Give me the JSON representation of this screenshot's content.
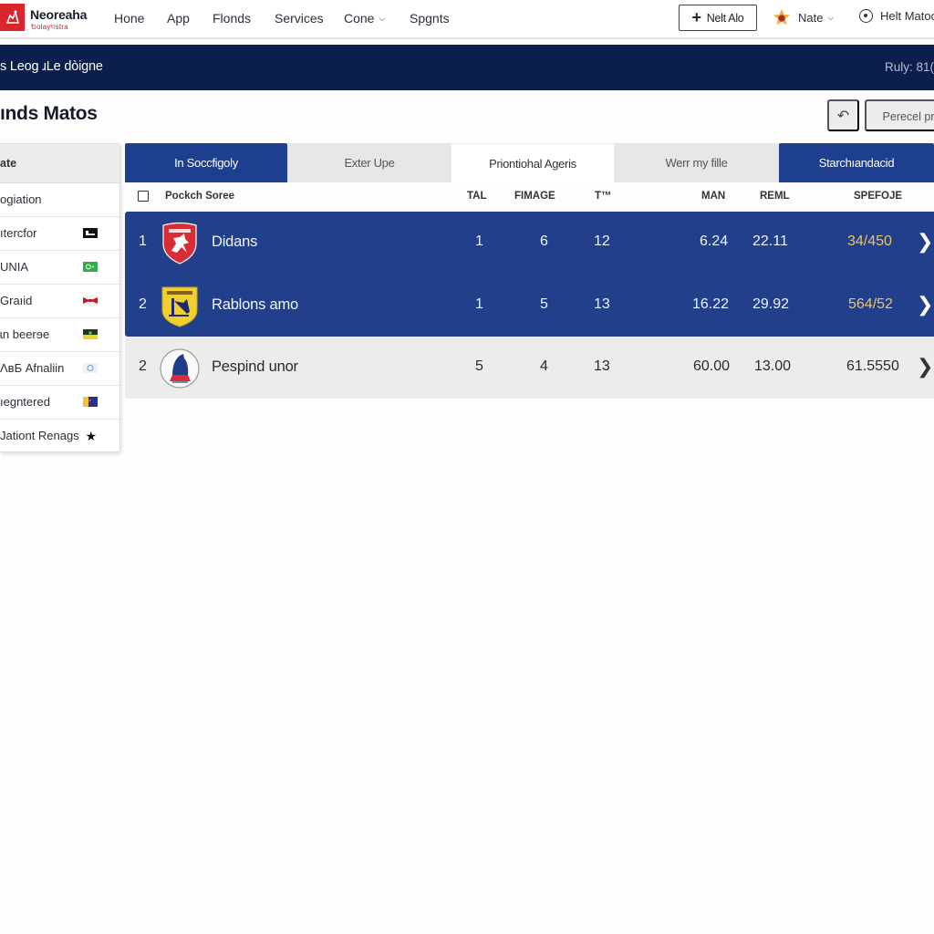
{
  "nav": {
    "brand_name": "Neoreaha",
    "brand_sub": "Եolayঘstra",
    "links": [
      {
        "label": "Hone"
      },
      {
        "label": "App"
      },
      {
        "label": "Flonds"
      },
      {
        "label": "Services"
      },
      {
        "label": "Cone",
        "has_dropdown": true
      },
      {
        "label": "Spgnts"
      }
    ],
    "new_button": "Nelt Alo",
    "user_name": "Nate",
    "help_link": "Helt Matoc"
  },
  "banner": {
    "title": "s Leog ɹLe dòigne",
    "right_text": "Ruly: 81("
  },
  "page": {
    "title": "ınds Matos",
    "back_icon": "reply-arrow-icon",
    "action_button": "Perecel pro"
  },
  "sidebar": {
    "header": "ate",
    "items": [
      {
        "label": "ogiation",
        "flag": null
      },
      {
        "label": "ıtercfor",
        "flag": "black"
      },
      {
        "label": "UNIA",
        "flag": "green"
      },
      {
        "label": "Graıid",
        "flag": "red-white"
      },
      {
        "label": "ɩn beerɘe",
        "flag": "green-yellow"
      },
      {
        "label": "ɅвБ Afnaliin",
        "flag": "circle"
      },
      {
        "label": "ıegntered",
        "flag": "yellow-blue"
      },
      {
        "label": "Jationt Renags",
        "flag": "star"
      }
    ]
  },
  "tabs": [
    {
      "label": "In Soccfigoly",
      "state": "active"
    },
    {
      "label": "Exter Upe",
      "state": "grey"
    },
    {
      "label": "Priontiohal Ageris",
      "state": "white"
    },
    {
      "label": "Werr my fille",
      "state": "grey"
    },
    {
      "label": "Starchıandacid",
      "state": "active"
    }
  ],
  "table": {
    "headers": {
      "team": "Pockch Soree",
      "c1": "TAL",
      "c2": "FIMAGE",
      "c3": "T™",
      "c4": "MAN",
      "c5": "REML",
      "c6": "SPEFOJE"
    },
    "rows": [
      {
        "rank": "1",
        "name": "Didans",
        "crest": "red-shield",
        "c1": "1",
        "c2": "6",
        "c3": "12",
        "c4": "6.24",
        "c5": "22.11",
        "c6": "34/450",
        "style": "dark"
      },
      {
        "rank": "2",
        "name": "Rablons amo",
        "crest": "yellow-shield",
        "c1": "1",
        "c2": "5",
        "c3": "13",
        "c4": "16.22",
        "c5": "29.92",
        "c6": "564/52",
        "style": "dark"
      },
      {
        "rank": "2",
        "name": "Pespind unor",
        "crest": "round-badge",
        "c1": "5",
        "c2": "4",
        "c3": "13",
        "c4": "60.00",
        "c5": "13.00",
        "c6": "61.5550",
        "style": "light"
      }
    ]
  },
  "colors": {
    "brand_red": "#d8262c",
    "banner_navy": "#0b1f4e",
    "active_blue": "#1e3e8f",
    "score_gold": "#e8c56a",
    "row_grey": "#ececec"
  }
}
